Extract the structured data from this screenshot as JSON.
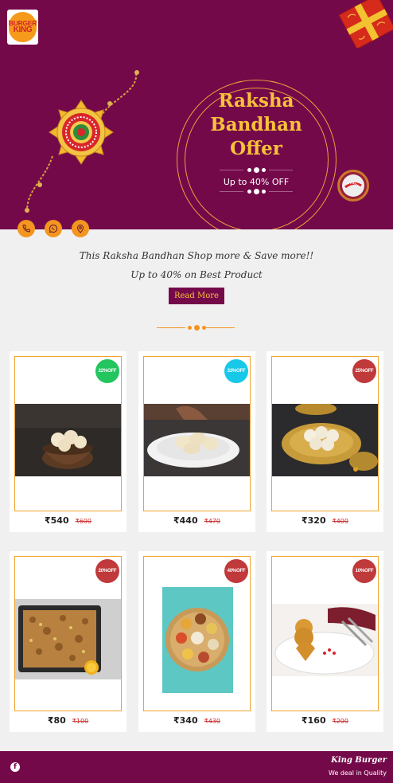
{
  "brand": {
    "logo_line1": "BURGER",
    "logo_line2": "KING"
  },
  "hero": {
    "title_line1": "Raksha",
    "title_line2": "Bandhan",
    "title_line3": "Offer",
    "subtitle": "Up to 40% OFF",
    "background_color": "#74094a",
    "accent_color": "#f7c13a"
  },
  "social_buttons": [
    {
      "icon": "phone-icon"
    },
    {
      "icon": "whatsapp-icon"
    },
    {
      "icon": "location-pin-icon"
    }
  ],
  "intro": {
    "line1": "This Raksha Bandhan Shop more & Save more!!",
    "line2": "Up to 40% on Best Product",
    "button_label": "Read More"
  },
  "products": [
    {
      "discount": "22%OFF",
      "badge_color": "#22c55e",
      "price": "₹540",
      "old_price": "₹600",
      "image": "rasgulla-bowl"
    },
    {
      "discount": "33%OFF",
      "badge_color": "#18c8e8",
      "price": "₹440",
      "old_price": "₹470",
      "image": "rasmalai-plate"
    },
    {
      "discount": "25%OFF",
      "badge_color": "#c0393b",
      "price": "₹320",
      "old_price": "₹400",
      "image": "rasgulla-brass-plate"
    },
    {
      "discount": "20%OFF",
      "badge_color": "#c0393b",
      "price": "₹80",
      "old_price": "₹100",
      "image": "biryani-tray"
    },
    {
      "discount": "40%OFF",
      "badge_color": "#c0393b",
      "price": "₹340",
      "old_price": "₹430",
      "image": "thali-plate"
    },
    {
      "discount": "10%OFF",
      "badge_color": "#c0393b",
      "price": "₹160",
      "old_price": "₹200",
      "image": "cutlet-plate"
    }
  ],
  "footer": {
    "brand": "King Burger",
    "tagline": "We deal in Quality",
    "icon": "facebook-icon"
  }
}
